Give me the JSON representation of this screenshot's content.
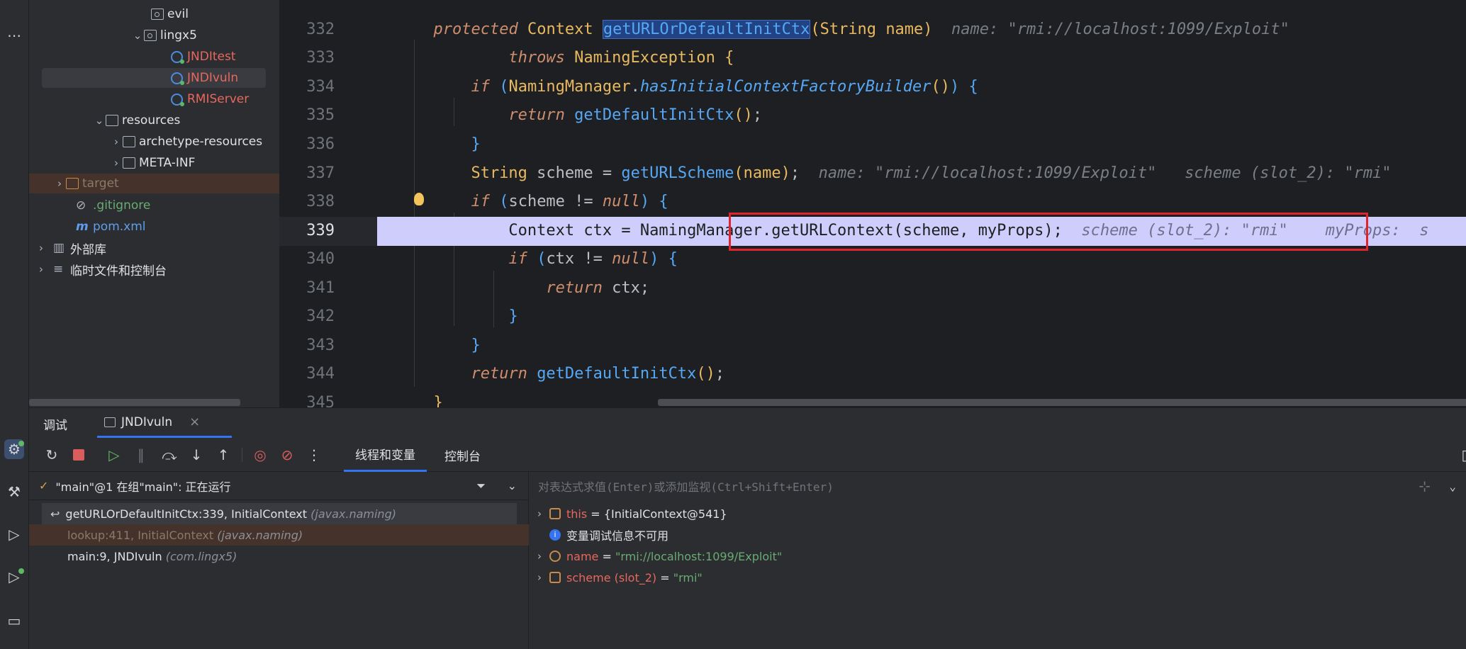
{
  "project_tree": {
    "items": [
      {
        "label": "evil"
      },
      {
        "label": "lingx5"
      },
      {
        "label": "JNDItest"
      },
      {
        "label": "JNDIvuln"
      },
      {
        "label": "RMIServer"
      },
      {
        "label": "resources"
      },
      {
        "label": "archetype-resources"
      },
      {
        "label": "META-INF"
      },
      {
        "label": "target"
      },
      {
        "label": ".gitignore"
      },
      {
        "label": "pom.xml"
      },
      {
        "label": "外部库"
      },
      {
        "label": "临时文件和控制台"
      }
    ]
  },
  "editor": {
    "line_numbers": [
      "332",
      "333",
      "334",
      "335",
      "336",
      "337",
      "338",
      "339",
      "340",
      "341",
      "342",
      "343",
      "344",
      "345"
    ],
    "hints": {
      "l332": "name: \"rmi://localhost:1099/Exploit\"",
      "l337a": "name: \"rmi://localhost:1099/Exploit\"",
      "l337b": "scheme (slot_2): \"rmi\"",
      "l339a": "scheme (slot_2): \"rmi\"",
      "l339b": "myProps:  s"
    }
  },
  "debug": {
    "title": "调试",
    "tab_label": "JNDIvuln",
    "subtabs": [
      "线程和变量",
      "控制台"
    ],
    "thread_status": "\"main\"@1 在组\"main\": 正在运行",
    "frames": [
      {
        "method": "getURLOrDefaultInitCtx:339, InitialContext",
        "pkg": "(javax.naming)"
      },
      {
        "method": "lookup:411, InitialContext",
        "pkg": "(javax.naming)"
      },
      {
        "method": "main:9, JNDIvuln",
        "pkg": "(com.lingx5)"
      }
    ],
    "eval_placeholder": "对表达式求值(Enter)或添加监视(Ctrl+Shift+Enter)",
    "variables": [
      {
        "name": "this",
        "value": "{InitialContext@541}"
      },
      {
        "info": "变量调试信息不可用"
      },
      {
        "name": "name",
        "value": "\"rmi://localhost:1099/Exploit\""
      },
      {
        "name": "scheme (slot_2)",
        "value": "\"rmi\""
      }
    ]
  },
  "colors": {
    "exec_line": "#cfcdfb",
    "breakpoint_box": "#e0242e",
    "accent": "#3574f0"
  }
}
